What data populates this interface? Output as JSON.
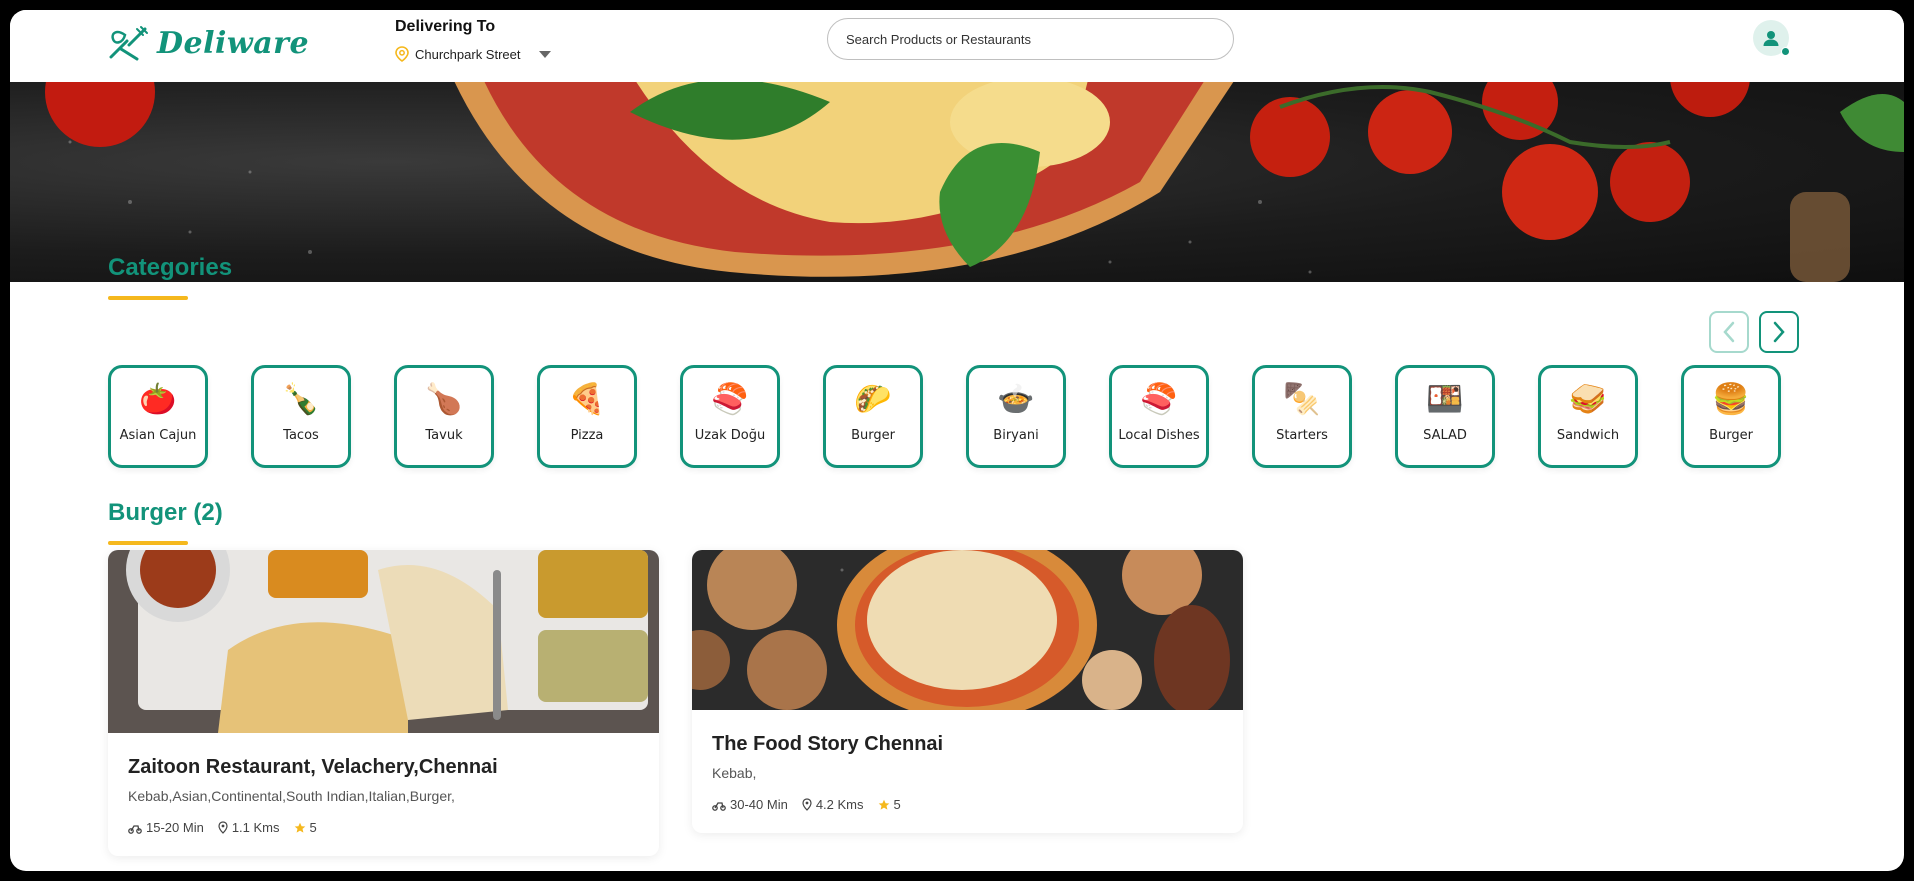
{
  "header": {
    "logo_text": "Deliware",
    "delivering_label": "Delivering To",
    "location": "Churchpark Street",
    "search_placeholder": "Search Products or Restaurants"
  },
  "categories_section": {
    "title": "Categories",
    "items": [
      {
        "label": "Asian Cajun",
        "icon": "🍅"
      },
      {
        "label": "Tacos",
        "icon": "🍾"
      },
      {
        "label": "Tavuk",
        "icon": "🍗"
      },
      {
        "label": "Pizza",
        "icon": "🍕"
      },
      {
        "label": "Uzak Doğu",
        "icon": "🍣"
      },
      {
        "label": "Burger",
        "icon": "🌮"
      },
      {
        "label": "Biryani",
        "icon": "🍲"
      },
      {
        "label": "Local Dishes",
        "icon": "🍣"
      },
      {
        "label": "Starters",
        "icon": "🍢"
      },
      {
        "label": "SALAD",
        "icon": "🍱"
      },
      {
        "label": "Sandwich",
        "icon": "🥪"
      },
      {
        "label": "Burger",
        "icon": "🍔"
      }
    ]
  },
  "results_section": {
    "title": "Burger (2)",
    "restaurants": [
      {
        "name": "Zaitoon Restaurant, Velachery,Chennai",
        "cuisines": "Kebab,Asian,Continental,South Indian,Italian,Burger,",
        "time": "15-20 Min",
        "distance": "1.1 Kms",
        "rating": "5"
      },
      {
        "name": "The Food Story Chennai",
        "cuisines": "Kebab,",
        "time": "30-40 Min",
        "distance": "4.2 Kms",
        "rating": "5"
      }
    ]
  },
  "colors": {
    "brand": "#12937a",
    "accent": "#f5b81d"
  }
}
